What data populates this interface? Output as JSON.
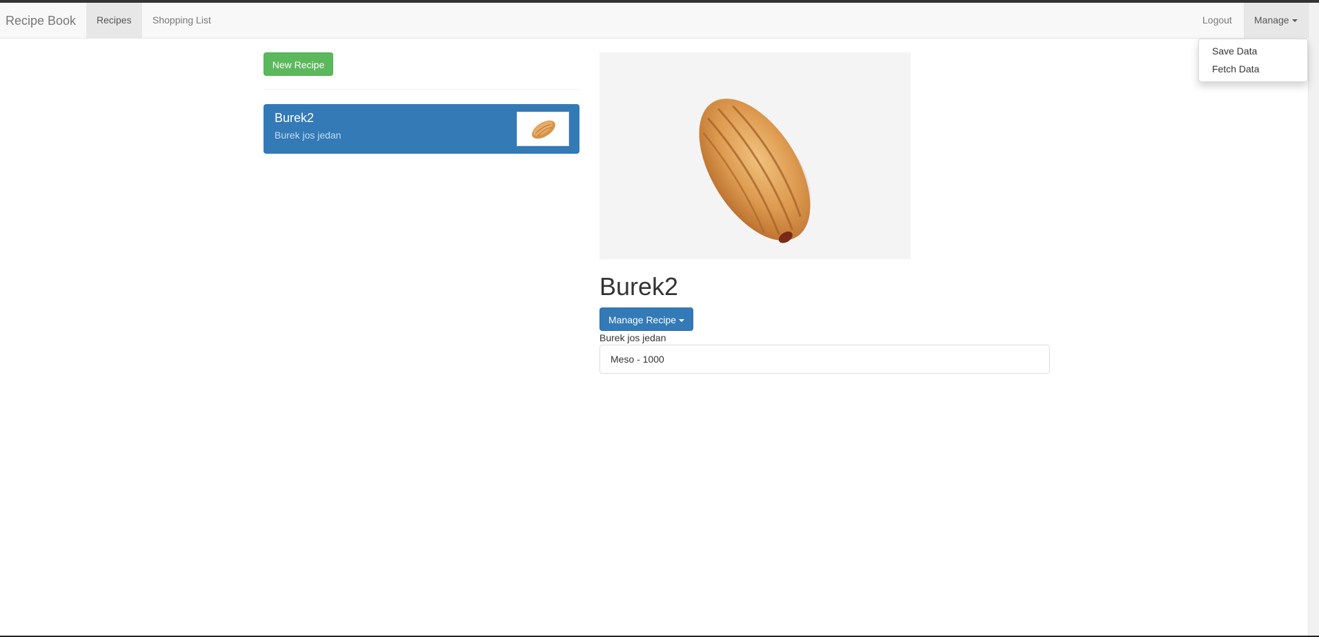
{
  "navbar": {
    "brand": "Recipe Book",
    "links": [
      {
        "label": "Recipes",
        "active": true
      },
      {
        "label": "Shopping List",
        "active": false
      }
    ],
    "logout_label": "Logout",
    "manage_label": "Manage"
  },
  "manage_dropdown": {
    "items": [
      {
        "label": "Save Data"
      },
      {
        "label": "Fetch Data"
      }
    ]
  },
  "recipe_list": {
    "new_recipe_label": "New Recipe",
    "items": [
      {
        "name": "Burek2",
        "description": "Burek jos jedan",
        "selected": true,
        "thumbnail_icon": "burek-pastry-image"
      }
    ]
  },
  "recipe_detail": {
    "image_icon": "burek-pastry-image",
    "name": "Burek2",
    "manage_recipe_label": "Manage Recipe",
    "description": "Burek jos jedan",
    "ingredients": [
      {
        "text": "Meso - 1000"
      }
    ]
  },
  "colors": {
    "primary": "#337ab7",
    "success": "#5cb85c",
    "navbar_bg": "#f8f8f8",
    "active_nav_bg": "#e7e7e7"
  }
}
